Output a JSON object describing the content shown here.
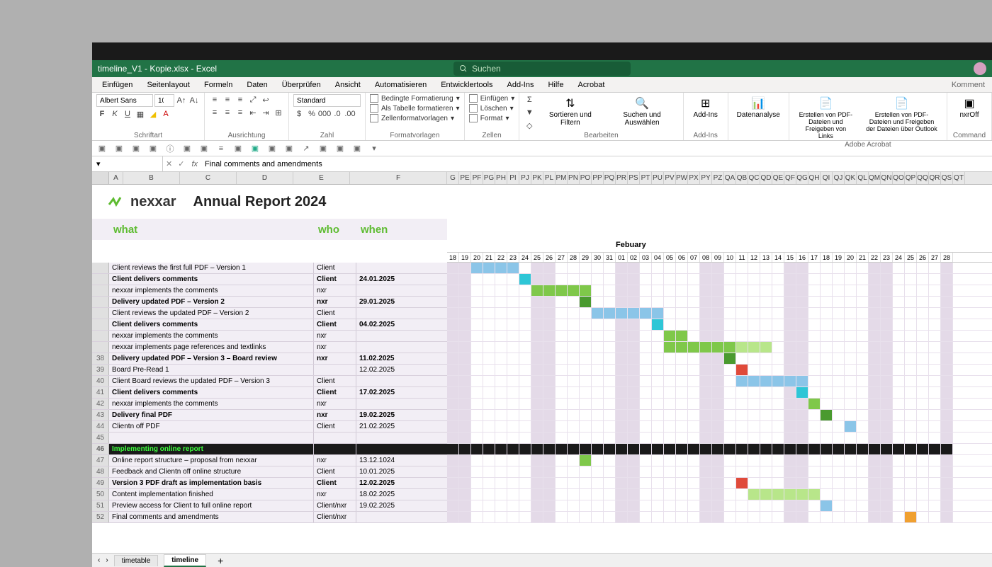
{
  "app": {
    "doc_title": "timeline_V1 - Kopie.xlsx - Excel",
    "search_placeholder": "Suchen",
    "comment_label": "Komment"
  },
  "ribbon_tabs": [
    "Einfügen",
    "Seitenlayout",
    "Formeln",
    "Daten",
    "Überprüfen",
    "Ansicht",
    "Automatisieren",
    "Entwicklertools",
    "Add-Ins",
    "Hilfe",
    "Acrobat"
  ],
  "ribbon": {
    "font_name": "Albert Sans",
    "font_size": "10",
    "number_format": "Standard",
    "group_schrift": "Schriftart",
    "group_ausricht": "Ausrichtung",
    "group_zahl": "Zahl",
    "group_formatv": "Formatvorlagen",
    "group_zellen": "Zellen",
    "group_bearbeiten": "Bearbeiten",
    "group_addins": "Add-Ins",
    "group_adobe": "Adobe Acrobat",
    "group_command": "Command",
    "bedingte": "Bedingte Formatierung",
    "als_tabelle": "Als Tabelle formatieren",
    "zellenformatv": "Zellenformatvorlagen",
    "einfuegen": "Einfügen",
    "loeschen": "Löschen",
    "format": "Format",
    "sortieren": "Sortieren und Filtern",
    "suchen": "Suchen und Auswählen",
    "addins_btn": "Add-Ins",
    "datenanalyse": "Datenanalyse",
    "pdf1": "Erstellen von PDF-Dateien und Freigeben von Links",
    "pdf2": "Erstellen von PDF-Dateien und Freigeben der Dateien über Outlook",
    "nxr_btn": "nxrOff"
  },
  "formula_bar": {
    "fx": "fx",
    "content": "Final comments and amendments"
  },
  "columns_main": [
    "A",
    "B",
    "C",
    "D",
    "E",
    "F"
  ],
  "columns_gantt": [
    "G",
    "PE",
    "PF",
    "PG",
    "PH",
    "PI",
    "PJ",
    "PK",
    "PL",
    "PM",
    "PN",
    "PO",
    "PP",
    "PQ",
    "PR",
    "PS",
    "PT",
    "PU",
    "PV",
    "PW",
    "PX",
    "PY",
    "PZ",
    "QA",
    "QB",
    "QC",
    "QD",
    "QE",
    "QF",
    "QG",
    "QH",
    "QI",
    "QJ",
    "QK",
    "QL",
    "QM",
    "QN",
    "QO",
    "QP",
    "QQ",
    "QR",
    "QS",
    "QT"
  ],
  "report": {
    "brand": "nexxar",
    "title": "Annual Report 2024",
    "h_what": "what",
    "h_who": "who",
    "h_when": "when"
  },
  "months": {
    "jan": "",
    "feb": "Febuary"
  },
  "days": [
    "18",
    "19",
    "20",
    "21",
    "22",
    "23",
    "24",
    "25",
    "26",
    "27",
    "28",
    "29",
    "30",
    "31",
    "01",
    "02",
    "03",
    "04",
    "05",
    "06",
    "07",
    "08",
    "09",
    "10",
    "11",
    "12",
    "13",
    "14",
    "15",
    "16",
    "17",
    "18",
    "19",
    "20",
    "21",
    "22",
    "23",
    "24",
    "25",
    "26",
    "27",
    "28"
  ],
  "tasks": [
    {
      "row": "",
      "what": "Client reviews the first full PDF – Version 1",
      "who": "Client",
      "when": "",
      "bold": false
    },
    {
      "row": "",
      "what": "Client delivers comments",
      "who": "Client",
      "when": "24.01.2025",
      "bold": true
    },
    {
      "row": "",
      "what": "nexxar implements the comments",
      "who": "nxr",
      "when": "",
      "bold": false
    },
    {
      "row": "",
      "what": "Delivery updated PDF – Version 2",
      "who": "nxr",
      "when": "29.01.2025",
      "bold": true
    },
    {
      "row": "",
      "what": "Client reviews the updated PDF – Version 2",
      "who": "Client",
      "when": "",
      "bold": false
    },
    {
      "row": "",
      "what": "Client delivers comments",
      "who": "Client",
      "when": "04.02.2025",
      "bold": true
    },
    {
      "row": "",
      "what": "nexxar implements the comments",
      "who": "nxr",
      "when": "",
      "bold": false
    },
    {
      "row": "",
      "what": "nexxar implements page references and textlinks",
      "who": "nxr",
      "when": "",
      "bold": false
    },
    {
      "row": "38",
      "what": "Delivery updated PDF – Version 3 – Board review",
      "who": "nxr",
      "when": "11.02.2025",
      "bold": true
    },
    {
      "row": "39",
      "what": "Board Pre-Read 1",
      "who": "",
      "when": "12.02.2025",
      "bold": false
    },
    {
      "row": "40",
      "what": "Client Board reviews the updated PDF – Version 3",
      "who": "Client",
      "when": "",
      "bold": false
    },
    {
      "row": "41",
      "what": "Client delivers comments",
      "who": "Client",
      "when": "17.02.2025",
      "bold": true
    },
    {
      "row": "42",
      "what": "nexxar implements the comments",
      "who": "nxr",
      "when": "",
      "bold": false
    },
    {
      "row": "43",
      "what": "Delivery final PDF",
      "who": "nxr",
      "when": "19.02.2025",
      "bold": true
    },
    {
      "row": "44",
      "what": "Clientn off PDF",
      "who": "Client",
      "when": "21.02.2025",
      "bold": false
    },
    {
      "row": "45",
      "what": "",
      "who": "",
      "when": "",
      "bold": false
    },
    {
      "row": "46",
      "what": "Implementing online report",
      "who": "",
      "when": "",
      "bold": true,
      "section": true
    },
    {
      "row": "47",
      "what": "Online report structure – proposal from nexxar",
      "who": "nxr",
      "when": "13.12.1024",
      "bold": false
    },
    {
      "row": "48",
      "what": "Feedback and Clientn off online structure",
      "who": "Client",
      "when": "10.01.2025",
      "bold": false
    },
    {
      "row": "49",
      "what": "Version 3 PDF draft as implementation basis",
      "who": "Client",
      "when": "12.02.2025",
      "bold": true
    },
    {
      "row": "50",
      "what": "Content implementation finished",
      "who": "nxr",
      "when": "18.02.2025",
      "bold": false
    },
    {
      "row": "51",
      "what": "Preview access for Client to full online report",
      "who": "Client/nxr",
      "when": "19.02.2025",
      "bold": false
    },
    {
      "row": "52",
      "what": "Final comments and amendments",
      "who": "Client/nxr",
      "when": "",
      "bold": false
    }
  ],
  "weekend_cols": [
    0,
    1,
    7,
    8,
    14,
    15,
    21,
    22,
    28,
    29,
    35,
    36,
    41
  ],
  "gantt": [
    [
      [
        "blue",
        2,
        5
      ]
    ],
    [
      [
        "cyan",
        6,
        6
      ]
    ],
    [
      [
        "green",
        7,
        11
      ]
    ],
    [
      [
        "dgreen",
        11,
        11
      ]
    ],
    [
      [
        "blue",
        12,
        17
      ]
    ],
    [
      [
        "cyan",
        17,
        17
      ]
    ],
    [
      [
        "green",
        18,
        19
      ]
    ],
    [
      [
        "green",
        18,
        23
      ],
      [
        "lgreen",
        24,
        26
      ]
    ],
    [
      [
        "dgreen",
        23,
        23
      ]
    ],
    [
      [
        "red",
        24,
        24
      ]
    ],
    [
      [
        "blue",
        24,
        29
      ]
    ],
    [
      [
        "cyan",
        29,
        29
      ]
    ],
    [
      [
        "green",
        30,
        30
      ]
    ],
    [
      [
        "dgreen",
        31,
        31
      ]
    ],
    [
      [
        "blue",
        33,
        33
      ]
    ],
    [],
    [],
    [
      [
        "green",
        11,
        11
      ]
    ],
    [],
    [
      [
        "red",
        24,
        24
      ]
    ],
    [
      [
        "lgreen",
        25,
        30
      ]
    ],
    [
      [
        "blue",
        31,
        31
      ]
    ],
    [
      [
        "orange",
        38,
        38
      ]
    ]
  ],
  "sheet_tabs": {
    "t1": "timetable",
    "t2": "timeline",
    "add": "+"
  }
}
